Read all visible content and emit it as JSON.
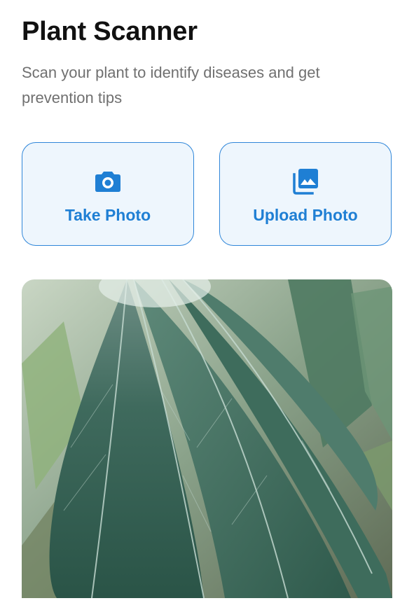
{
  "header": {
    "title": "Plant Scanner",
    "subtitle": "Scan your plant to identify diseases and get prevention tips"
  },
  "actions": {
    "take_photo": {
      "label": "Take Photo",
      "icon": "camera-icon"
    },
    "upload_photo": {
      "label": "Upload Photo",
      "icon": "photo-library-icon"
    }
  },
  "colors": {
    "accent": "#1f7fd4",
    "button_bg": "#eef6fd",
    "button_border": "#2f86d9",
    "title": "#111111",
    "subtitle": "#707070"
  }
}
